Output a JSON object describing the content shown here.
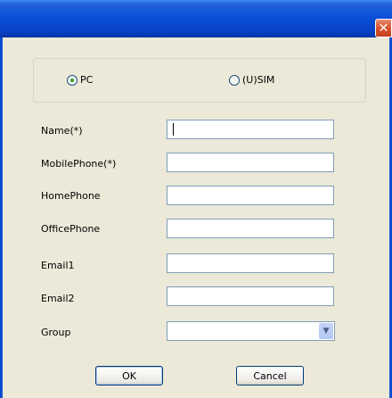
{
  "window": {
    "close_glyph": "✕"
  },
  "mode": {
    "options": [
      {
        "label": "PC",
        "checked": true
      },
      {
        "label": "(U)SIM",
        "checked": false
      }
    ]
  },
  "form": {
    "fields": [
      {
        "label": "Name(*)",
        "value": "",
        "type": "text"
      },
      {
        "label": "MobilePhone(*)",
        "value": "",
        "type": "text"
      },
      {
        "label": "HomePhone",
        "value": "",
        "type": "text"
      },
      {
        "label": "OfficePhone",
        "value": "",
        "type": "text"
      },
      {
        "label": "Email1",
        "value": "",
        "type": "text"
      },
      {
        "label": "Email2",
        "value": "",
        "type": "text"
      },
      {
        "label": "Group",
        "value": "",
        "type": "select"
      }
    ]
  },
  "buttons": {
    "ok_label": "OK",
    "cancel_label": "Cancel"
  },
  "icons": {
    "dropdown": "chevron-down-icon",
    "close": "close-icon"
  }
}
